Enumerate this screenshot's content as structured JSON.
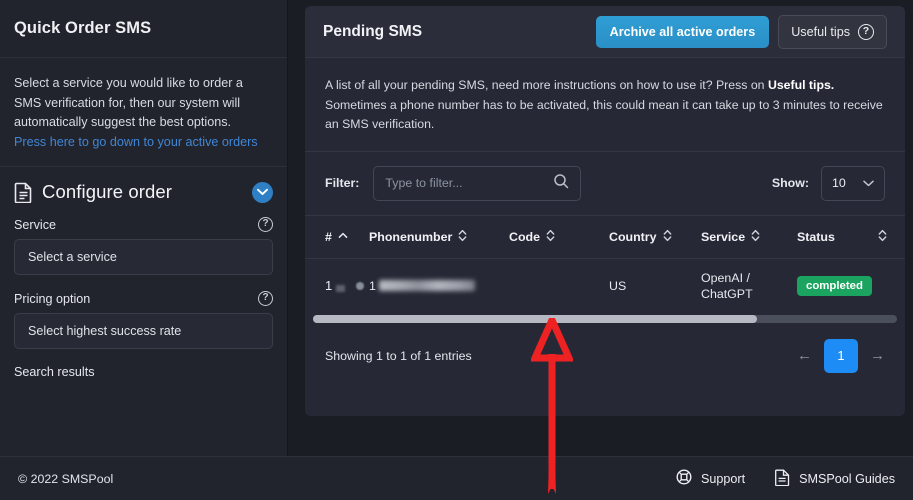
{
  "sidebar": {
    "title": "Quick Order SMS",
    "description": "Select a service you would like to order a SMS verification for, then our system will automatically suggest the best options.",
    "link_text": "Press here to go down to your active orders",
    "configure": {
      "heading": "Configure order",
      "doc_icon": "document-icon",
      "collapse_icon": "chevron-down-circle-icon",
      "service_label": "Service",
      "service_help_icon": "question-mark-icon",
      "service_value": "Select a service",
      "pricing_label": "Pricing option",
      "pricing_help_icon": "question-mark-icon",
      "pricing_value": "Select highest success rate",
      "search_results_label": "Search results"
    }
  },
  "main": {
    "title": "Pending SMS",
    "archive_button": "Archive all active orders",
    "useful_tips_button": "Useful tips",
    "useful_tips_icon": "question-mark-circle-icon",
    "description_part1": "A list of all your pending SMS, need more instructions on how to use it? Press on ",
    "description_bold": "Useful tips.",
    "description_part2": " Sometimes a phone number has to be activated, this could mean it can take up to 3 minutes to receive an SMS verification.",
    "filter_label": "Filter:",
    "filter_value": "",
    "filter_placeholder": "Type to filter...",
    "search_icon": "search-icon",
    "show_label": "Show:",
    "show_value": "10",
    "show_chevron_icon": "chevron-down-icon",
    "table": {
      "columns": [
        {
          "label": "#",
          "sort_icon": "sort-ascending-icon"
        },
        {
          "label": "Phonenumber",
          "sort_icon": "sort-both-icon"
        },
        {
          "label": "Code",
          "sort_icon": "sort-both-icon"
        },
        {
          "label": "Country",
          "sort_icon": "sort-both-icon"
        },
        {
          "label": "Service",
          "sort_icon": "sort-both-icon"
        },
        {
          "label": "Status",
          "sort_icon": "sort-both-icon"
        }
      ],
      "rows": [
        {
          "index": "1",
          "phone_prefix": "1",
          "phone_redacted": true,
          "code_redacted": true,
          "country": "US",
          "service": "OpenAI / ChatGPT",
          "status": "completed",
          "status_color": "#1aa45f"
        }
      ]
    },
    "scrollbar": {
      "name": "horizontal-scrollbar",
      "thumb_percent": 76
    },
    "entries_text": "Showing 1 to 1 of 1 entries",
    "pagination": {
      "prev_icon": "arrow-left-icon",
      "next_icon": "arrow-right-icon",
      "current_page": "1",
      "active_color": "#1e8cf5"
    }
  },
  "footer": {
    "copyright": "© 2022 SMSPool",
    "links": [
      {
        "label": "Support",
        "icon": "support-icon"
      },
      {
        "label": "SMSPool Guides",
        "icon": "document-guide-icon"
      }
    ]
  },
  "annotation": {
    "type": "red-up-arrow",
    "color": "#ee2222",
    "points_at": "code-column-cell"
  }
}
